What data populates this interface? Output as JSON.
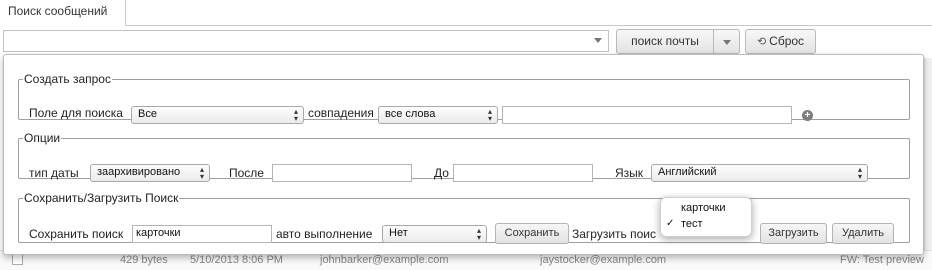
{
  "tab": {
    "label": "Поиск сообщений"
  },
  "search": {
    "value": ""
  },
  "toolbar": {
    "mail_search_label": "поиск почты",
    "reset_label": "Сброс"
  },
  "query": {
    "legend": "Создать запрос",
    "field_label": "Поле для поиска",
    "field_value": "Все",
    "match_label": "совпадения",
    "match_value": "все слова",
    "term_value": ""
  },
  "options": {
    "legend": "Опции",
    "date_type_label": "тип даты",
    "date_type_value": "заархивировано",
    "after_label": "После",
    "after_value": "",
    "before_label": "До",
    "before_value": "",
    "language_label": "Язык",
    "language_value": "Английский"
  },
  "saveload": {
    "legend": "Сохранить/Загрузить Поиск",
    "save_label": "Сохранить поиск",
    "save_value": "карточки",
    "autorun_label": "авто выполнение",
    "autorun_value": "Нет",
    "save_button": "Сохранить",
    "load_label": "Загрузить поис",
    "load_button": "Загрузить",
    "delete_button": "Удалить"
  },
  "load_dropdown": {
    "options": [
      {
        "label": "карточки",
        "checked": false
      },
      {
        "label": "тест",
        "checked": true
      }
    ],
    "check_glyph": "✓"
  },
  "background_row": {
    "size": "429 bytes",
    "date": "5/10/2013 8:06 PM",
    "from": "johnbarker@example.com",
    "to": "jaystocker@example.com",
    "subject": "FW: Test preview"
  }
}
